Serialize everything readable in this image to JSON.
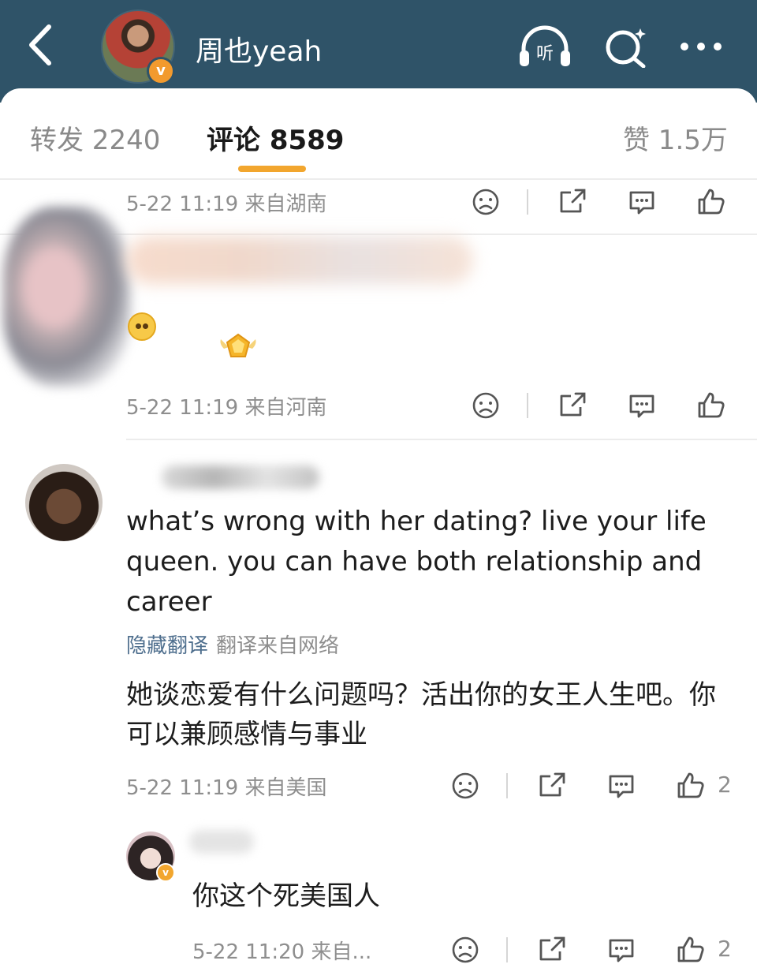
{
  "header": {
    "title": "周也yeah",
    "badge": "v",
    "icons": [
      "back-icon",
      "listen-icon",
      "search-icon",
      "more-icon"
    ],
    "listen_label": "听",
    "bg_color": "#2f5368"
  },
  "tabs": {
    "repost": "转发 2240",
    "comments": "评论 8589",
    "likes": "赞 1.5万",
    "accent": "#f2a62e"
  },
  "comments": [
    {
      "time": "5-22 11:19 来自湖南"
    },
    {
      "time": "5-22 11:19 来自河南"
    },
    {
      "text": "what’s wrong with her dating? live your life queen. you can have both relationship and career",
      "hide_translation": "隐藏翻译",
      "translation_source": "翻译来自网络",
      "translation": "她谈恋爱有什么问题吗？活出你的女王人生吧。你可以兼顾感情与事业",
      "time": "5-22 11:19 来自美国",
      "likes": "2"
    },
    {
      "badge": "v",
      "text": "你这个死美国人",
      "time": "5-22 11:20 来自...",
      "likes": "2"
    }
  ]
}
